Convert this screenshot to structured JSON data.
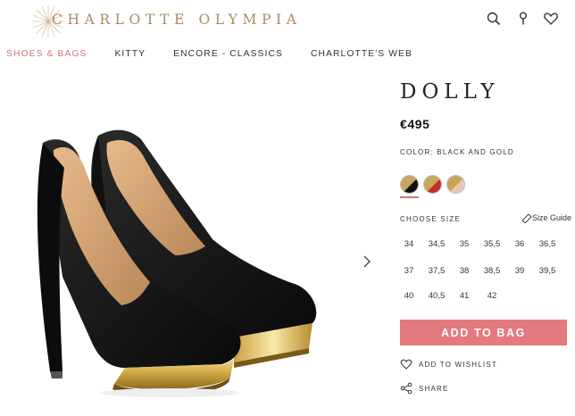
{
  "header": {
    "logo_text": "CHARLOTTE OLYMPIA",
    "icons": [
      "search-icon",
      "location-pin-icon",
      "heart-icon"
    ]
  },
  "nav": {
    "items": [
      {
        "label": "SHOES & BAGS",
        "active": true
      },
      {
        "label": "KITTY",
        "active": false
      },
      {
        "label": "ENCORE - CLASSICS",
        "active": false
      },
      {
        "label": "CHARLOTTE'S WEB",
        "active": false
      }
    ]
  },
  "product": {
    "name": "DOLLY",
    "price": "€495",
    "color_label": "COLOR: BLACK AND GOLD",
    "swatches": [
      {
        "name": "black-and-gold",
        "color_a": "#111111",
        "color_b": "#c8a45c"
      },
      {
        "name": "red-and-gold",
        "color_a": "#c42d25",
        "color_b": "#c8a45c"
      },
      {
        "name": "nude-and-gold",
        "color_a": "#e8c7b2",
        "color_b": "#c8a45c"
      }
    ],
    "size_label": "CHOOSE SIZE",
    "size_guide": "Size Guide",
    "sizes": [
      "34",
      "34,5",
      "35",
      "35,5",
      "36",
      "36,5",
      "37",
      "37,5",
      "38",
      "38,5",
      "39",
      "39,5",
      "40",
      "40,5",
      "41",
      "42"
    ],
    "add_to_bag": "ADD TO BAG",
    "wishlist": "ADD TO WISHLIST",
    "share": "SHARE"
  },
  "colors": {
    "accent": "#e47a80",
    "nav_active": "#c9797e",
    "logo": "#a98c62"
  }
}
